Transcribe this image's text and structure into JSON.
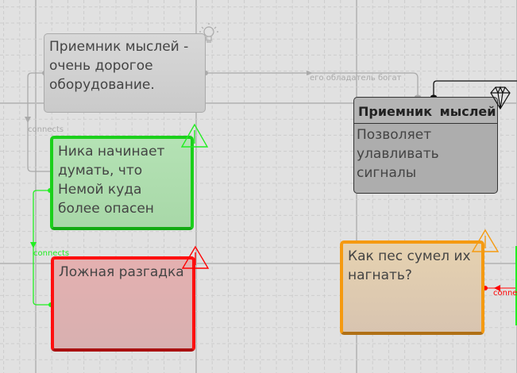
{
  "nodes": [
    {
      "text": "Приемник мыслей - очень дорогое оборудование.",
      "icon": "lightbulb-icon"
    },
    {
      "text": "Ника начинает думать, что Немой куда более опасен",
      "icon": "warning-icon"
    },
    {
      "text": "Ложная разгадка",
      "icon": "warning-icon"
    },
    {
      "text": "Как пес сумел их нагнать?",
      "icon": "warning-icon"
    },
    {
      "title": "Приемник мыслей",
      "text": "Позволяет улавливать сигналы",
      "icon": "diamond-icon"
    }
  ],
  "edges": [
    {
      "label": "connects",
      "color": "#aaaaaa"
    },
    {
      "label": "его обладатель богат",
      "color": "#aaaaaa"
    },
    {
      "label": "connects",
      "color": "#22ee22"
    },
    {
      "label": "connec",
      "color": "#ff0000"
    }
  ]
}
